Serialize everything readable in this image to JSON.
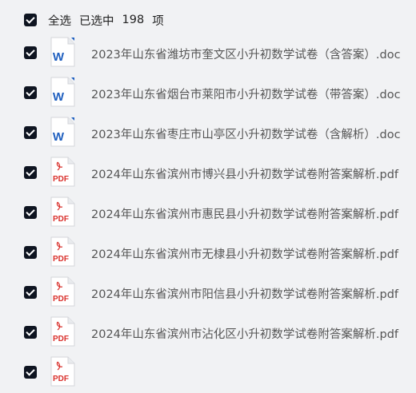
{
  "header": {
    "select_all_label": "全选",
    "selected_label": "已选中",
    "selected_count": "198",
    "unit_label": "项",
    "all_checked": true
  },
  "files": [
    {
      "name": "2023年山东省潍坊市奎文区小升初数学试卷（含答案）.doc",
      "type": "doc",
      "checked": true
    },
    {
      "name": "2023年山东省烟台市莱阳市小升初数学试卷（带答案）.doc",
      "type": "doc",
      "checked": true
    },
    {
      "name": "2023年山东省枣庄市山亭区小升初数学试卷（含解析）.doc",
      "type": "doc",
      "checked": true
    },
    {
      "name": "2024年山东省滨州市博兴县小升初数学试卷附答案解析.pdf",
      "type": "pdf",
      "checked": true
    },
    {
      "name": "2024年山东省滨州市惠民县小升初数学试卷附答案解析.pdf",
      "type": "pdf",
      "checked": true
    },
    {
      "name": "2024年山东省滨州市无棣县小升初数学试卷附答案解析.pdf",
      "type": "pdf",
      "checked": true
    },
    {
      "name": "2024年山东省滨州市阳信县小升初数学试卷附答案解析.pdf",
      "type": "pdf",
      "checked": true
    },
    {
      "name": "2024年山东省滨州市沾化区小升初数学试卷附答案解析.pdf",
      "type": "pdf",
      "checked": true
    },
    {
      "name": "",
      "type": "pdf",
      "checked": true
    }
  ],
  "icon_labels": {
    "doc": "W",
    "pdf": "PDF"
  },
  "colors": {
    "checkbox": "#0e1420",
    "pdf_red": "#d9302c",
    "doc_blue": "#1f5fbf"
  }
}
